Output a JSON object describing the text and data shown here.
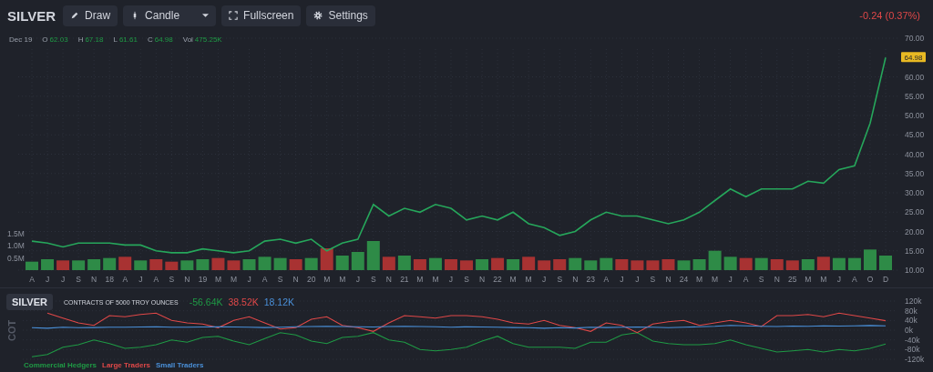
{
  "toolbar": {
    "symbol": "SILVER",
    "buttons": [
      {
        "kind": "draw",
        "label": "Draw"
      },
      {
        "kind": "chart_type",
        "label": "Candle"
      },
      {
        "kind": "fullscreen",
        "label": "Fullscreen"
      },
      {
        "kind": "settings",
        "label": "Settings"
      }
    ],
    "change": "-0.24 (0.37%)"
  },
  "ohlc": {
    "date": "Dec 19",
    "fields": [
      {
        "label": "O",
        "value": "62.03"
      },
      {
        "label": "H",
        "value": "67.18"
      },
      {
        "label": "L",
        "value": "61.61"
      },
      {
        "label": "C",
        "value": "64.98"
      },
      {
        "label": "Vol",
        "value": "475.25K"
      }
    ]
  },
  "price_chart": {
    "last_price": "64.98",
    "chart_data": {
      "type": "line",
      "categories": [
        "A",
        "J",
        "J",
        "S",
        "N",
        "18",
        "A",
        "J",
        "A",
        "S",
        "N",
        "19",
        "M",
        "M",
        "J",
        "A",
        "S",
        "N",
        "20",
        "M",
        "M",
        "J",
        "S",
        "N",
        "21",
        "M",
        "M",
        "J",
        "S",
        "N",
        "22",
        "M",
        "M",
        "J",
        "S",
        "N",
        "23",
        "A",
        "J",
        "J",
        "S",
        "N",
        "24",
        "M",
        "M",
        "J",
        "A",
        "S",
        "N",
        "25",
        "M",
        "M",
        "J",
        "A",
        "O",
        "D"
      ],
      "series": [
        {
          "color": "#26a65b",
          "values": [
            17.5,
            17,
            16,
            17,
            17,
            17,
            16.5,
            16.5,
            15,
            14.5,
            14.5,
            15.5,
            15,
            14.5,
            15,
            17.5,
            18,
            17,
            18,
            15,
            17,
            18,
            27,
            24,
            26,
            25,
            27,
            26,
            23,
            24,
            23,
            25,
            22,
            21,
            19,
            20,
            23,
            25,
            24,
            24,
            23,
            22,
            23,
            25,
            28,
            31,
            29,
            31,
            31,
            31,
            33,
            32.5,
            36,
            37,
            48,
            65
          ]
        }
      ],
      "ylim": [
        10,
        70
      ],
      "grid": true,
      "yticks": [
        {
          "value": 10,
          "label": "10.00"
        },
        {
          "value": 15,
          "label": "15.00"
        },
        {
          "value": 20,
          "label": "20.00"
        },
        {
          "value": 25,
          "label": "25.00"
        },
        {
          "value": 30,
          "label": "30.00"
        },
        {
          "value": 35,
          "label": "35.00"
        },
        {
          "value": 40,
          "label": "40.00"
        },
        {
          "value": 45,
          "label": "45.00"
        },
        {
          "value": 50,
          "label": "50.00"
        },
        {
          "value": 55,
          "label": "55.00"
        },
        {
          "value": 60,
          "label": "60.00"
        },
        {
          "value": 70,
          "label": "70.00"
        }
      ]
    }
  },
  "volume_chart": {
    "chart_data": {
      "type": "bar",
      "ylim": [
        0,
        1.5
      ],
      "series": [
        {
          "color": "#2e8b47",
          "values": [
            0.35,
            0.45,
            null,
            0.4,
            0.45,
            0.5,
            null,
            0.4,
            null,
            null,
            0.4,
            0.45,
            null,
            null,
            0.45,
            0.55,
            0.5,
            null,
            0.5,
            null,
            0.6,
            0.75,
            1.2,
            null,
            0.6,
            null,
            0.5,
            null,
            null,
            0.45,
            null,
            0.45,
            null,
            null,
            null,
            0.5,
            0.4,
            0.5,
            null,
            null,
            null,
            null,
            0.4,
            0.45,
            0.8,
            0.55,
            null,
            0.5,
            null,
            null,
            0.45,
            null,
            0.5,
            0.5,
            0.85,
            0.6
          ]
        },
        {
          "color": "#a83232",
          "values": [
            null,
            null,
            0.4,
            null,
            null,
            null,
            0.55,
            null,
            0.45,
            0.35,
            null,
            null,
            0.5,
            0.4,
            null,
            null,
            null,
            0.45,
            null,
            0.9,
            null,
            null,
            null,
            0.55,
            null,
            0.45,
            null,
            0.45,
            0.4,
            null,
            0.5,
            null,
            0.55,
            0.4,
            0.45,
            null,
            null,
            null,
            0.45,
            0.4,
            0.4,
            0.45,
            null,
            null,
            null,
            null,
            0.5,
            null,
            0.45,
            0.4,
            null,
            0.55,
            null,
            null,
            null,
            null
          ]
        }
      ],
      "yticks": [
        {
          "value": 1.5,
          "label": "1.5M"
        },
        {
          "value": 1,
          "label": "1.0M"
        },
        {
          "value": 0.5,
          "label": "0.5M"
        }
      ]
    }
  },
  "cot": {
    "symbol": "SILVER",
    "unit": "CONTRACTS OF 5000 TROY OUNCES",
    "axis_title": "COT",
    "readings": [
      "-56.64K",
      "38.52K",
      "18.12K"
    ],
    "chart_data": {
      "type": "line",
      "series": [
        {
          "name": "Commercial Hedgers",
          "color": "#1f9a45",
          "values": [
            -110,
            -100,
            -70,
            -60,
            -40,
            -55,
            -75,
            -70,
            -60,
            -40,
            -50,
            -30,
            -25,
            -45,
            -60,
            -35,
            -10,
            -20,
            -45,
            -55,
            -30,
            -25,
            -10,
            -40,
            -50,
            -80,
            -85,
            -80,
            -70,
            -45,
            -25,
            -55,
            -70,
            -70,
            -70,
            -75,
            -50,
            -50,
            -20,
            -10,
            -45,
            -55,
            -60,
            -60,
            -55,
            -40,
            -60,
            -75,
            -90,
            -85,
            -80,
            -90,
            -80,
            -85,
            -75,
            -57
          ]
        },
        {
          "name": "Large Traders",
          "color": "#e04848",
          "values": [
            null,
            70,
            50,
            30,
            20,
            60,
            55,
            65,
            70,
            40,
            30,
            25,
            10,
            40,
            55,
            30,
            5,
            10,
            45,
            55,
            20,
            10,
            -5,
            30,
            60,
            55,
            50,
            60,
            60,
            55,
            45,
            30,
            25,
            40,
            20,
            10,
            -5,
            30,
            20,
            -10,
            25,
            35,
            40,
            20,
            30,
            40,
            30,
            15,
            60,
            60,
            65,
            55,
            70,
            60,
            50,
            39
          ]
        },
        {
          "name": "Small Traders",
          "color": "#4a90d9",
          "values": [
            10,
            8,
            12,
            10,
            11,
            12,
            12,
            13,
            14,
            12,
            12,
            13,
            14,
            13,
            12,
            11,
            12,
            14,
            15,
            16,
            15,
            14,
            13,
            15,
            16,
            15,
            14,
            12,
            14,
            13,
            12,
            11,
            10,
            8,
            10,
            9,
            12,
            11,
            12,
            13,
            12,
            10,
            12,
            14,
            16,
            20,
            18,
            16,
            15,
            17,
            16,
            18,
            17,
            18,
            19,
            18
          ]
        }
      ],
      "ylim": [
        -120,
        120
      ],
      "grid": true,
      "yticks": [
        {
          "value": 120,
          "label": "120k"
        },
        {
          "value": 80,
          "label": "80k"
        },
        {
          "value": 40,
          "label": "40k"
        },
        {
          "value": 0,
          "label": "0k"
        },
        {
          "value": -40,
          "label": "-40k"
        },
        {
          "value": -80,
          "label": "-80k"
        },
        {
          "value": -120,
          "label": "-120k"
        }
      ]
    }
  }
}
